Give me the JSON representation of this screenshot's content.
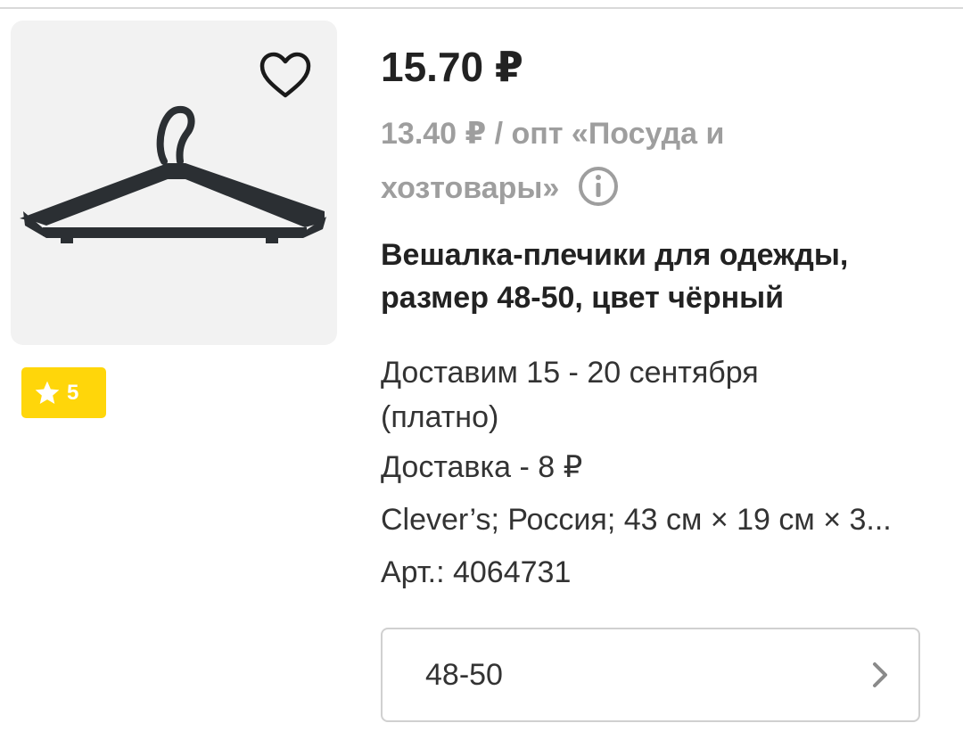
{
  "product": {
    "price": "15.70 ₽",
    "wholesale_line": "13.40 ₽ / опт «Посуда и хозтовары»",
    "title": "Вешалка-плечики для одежды, размер 48-50, цвет чёрный",
    "rating": "5",
    "delivery_date": "Доставим 15 - 20 сентября (платно)",
    "delivery_cost": "Доставка - 8 ₽",
    "specs": "Clever’s; Россия; 43 см × 19 см × 3...",
    "article": "Арт.: 4064731"
  },
  "size_selector": {
    "value": "48-50"
  },
  "icons": {
    "favorite": "heart-outline-icon",
    "info": "info-circle-icon",
    "rating": "star-icon",
    "chevron": "chevron-right-icon"
  },
  "colors": {
    "rating_badge": "#ffd60a",
    "muted_text": "#9e9e9e",
    "image_bg": "#f2f2f2"
  }
}
